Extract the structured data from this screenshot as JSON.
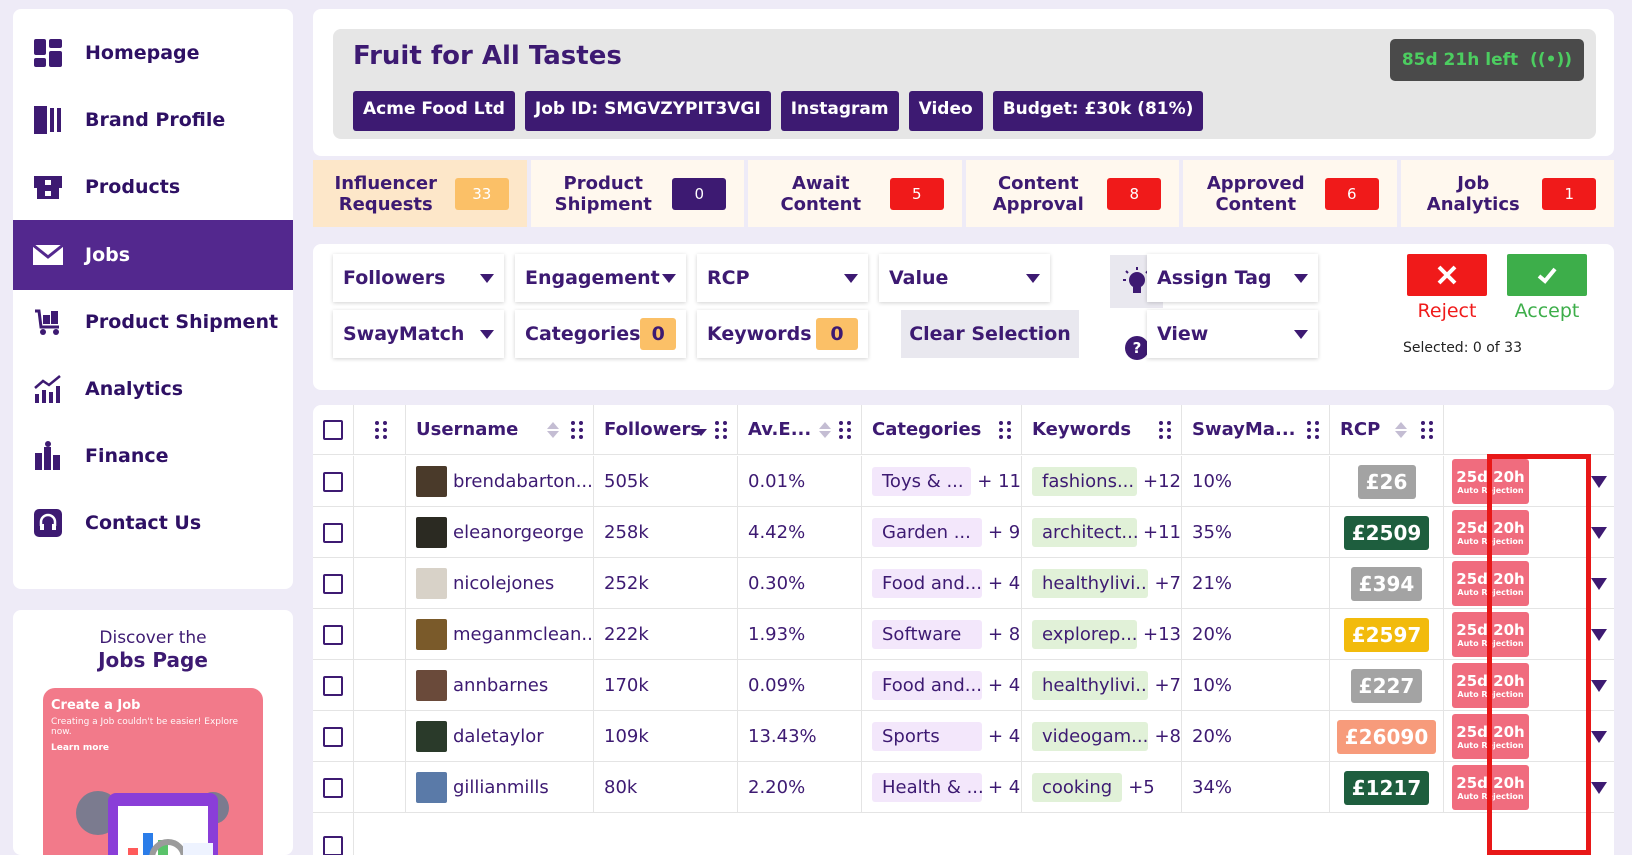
{
  "sidebar": {
    "items": [
      {
        "label": "Homepage",
        "icon": "dashboard-icon"
      },
      {
        "label": "Brand Profile",
        "icon": "profile-icon"
      },
      {
        "label": "Products",
        "icon": "products-icon"
      },
      {
        "label": "Jobs",
        "icon": "mail-icon",
        "active": true
      },
      {
        "label": "Product Shipment",
        "icon": "shipment-icon"
      },
      {
        "label": "Analytics",
        "icon": "analytics-icon"
      },
      {
        "label": "Finance",
        "icon": "finance-icon"
      },
      {
        "label": "Contact Us",
        "icon": "headset-icon"
      }
    ]
  },
  "promo": {
    "line1": "Discover the",
    "line2": "Jobs Page",
    "card_title": "Create a Job",
    "card_text": "Creating a Job couldn't be easier! Explore now.",
    "card_link": "Learn more"
  },
  "job": {
    "title": "Fruit for All Tastes",
    "tags": [
      "Acme Food Ltd",
      "Job ID: SMGVZYPIT3VGI",
      "Instagram",
      "Video",
      "Budget: £30k (81%)"
    ],
    "time_left": "85d 21h left",
    "time_left_color": "#4ccd60"
  },
  "tabs": [
    {
      "label": "Influencer Requests",
      "count": "33",
      "color": "#fbc067"
    },
    {
      "label": "Product Shipment",
      "count": "0",
      "color": "#3d1a72"
    },
    {
      "label": "Await Content",
      "count": "5",
      "color": "#f01a1a"
    },
    {
      "label": "Content Approval",
      "count": "8",
      "color": "#f01a1a"
    },
    {
      "label": "Approved Content",
      "count": "6",
      "color": "#f01a1a"
    },
    {
      "label": "Job Analytics",
      "count": "1",
      "color": "#f01a1a"
    }
  ],
  "filters": {
    "followers": "Followers",
    "engagement": "Engagement",
    "rcp": "RCP",
    "value": "Value",
    "swaymatch": "SwayMatch",
    "categories": "Categories",
    "categories_count": "0",
    "keywords": "Keywords",
    "keywords_count": "0",
    "clear": "Clear Selection",
    "assign_tag": "Assign Tag",
    "view": "View",
    "help": "?"
  },
  "actions": {
    "reject": "Reject",
    "accept": "Accept",
    "selected": "Selected: 0 of 33"
  },
  "table": {
    "columns": [
      "Username",
      "Followers",
      "Av.E...",
      "Categories",
      "Keywords",
      "SwayMa...",
      "RCP"
    ],
    "rows": [
      {
        "username": "brendabarton...",
        "followers": "505k",
        "engagement": "0.01%",
        "category": "Toys & ...",
        "cat_more": "+ 11",
        "keyword": "fashions...",
        "kw_more": "+12",
        "swaymatch": "10%",
        "rcp": "£26",
        "rcp_color": "#a3a3a3",
        "expiry": "25d 20h",
        "expiry_note": "Auto Rejection",
        "avatar_color": "#4a3a2a"
      },
      {
        "username": "eleanorgeorge",
        "followers": "258k",
        "engagement": "4.42%",
        "category": "Garden ...",
        "cat_more": "+ 9",
        "keyword": "architect...",
        "kw_more": "+11",
        "swaymatch": "35%",
        "rcp": "£2509",
        "rcp_color": "#1e5e3e",
        "expiry": "25d 20h",
        "expiry_note": "Auto Rejection",
        "avatar_color": "#2b2a22"
      },
      {
        "username": "nicolejones",
        "followers": "252k",
        "engagement": "0.30%",
        "category": "Food and...",
        "cat_more": "+ 4",
        "keyword": "healthylivi...",
        "kw_more": "+7",
        "swaymatch": "21%",
        "rcp": "£394",
        "rcp_color": "#a3a3a3",
        "expiry": "25d 20h",
        "expiry_note": "Auto Rejection",
        "avatar_color": "#d8d2c8"
      },
      {
        "username": "meganmclean...",
        "followers": "222k",
        "engagement": "1.93%",
        "category": "Software",
        "cat_more": "+ 8",
        "keyword": "explorep...",
        "kw_more": "+13",
        "swaymatch": "20%",
        "rcp": "£2597",
        "rcp_color": "#f2bb0c",
        "expiry": "25d 20h",
        "expiry_note": "Auto Rejection",
        "avatar_color": "#7a5a2a"
      },
      {
        "username": "annbarnes",
        "followers": "170k",
        "engagement": "0.09%",
        "category": "Food and...",
        "cat_more": "+ 4",
        "keyword": "healthylivi...",
        "kw_more": "+7",
        "swaymatch": "10%",
        "rcp": "£227",
        "rcp_color": "#a3a3a3",
        "expiry": "25d 20h",
        "expiry_note": "Auto Rejection",
        "avatar_color": "#6a4a3a"
      },
      {
        "username": "daletaylor",
        "followers": "109k",
        "engagement": "13.43%",
        "category": "Sports",
        "cat_more": "+ 4",
        "keyword": "videogam...",
        "kw_more": "+8",
        "swaymatch": "20%",
        "rcp": "£26090",
        "rcp_color": "#f79b7b",
        "expiry": "25d 20h",
        "expiry_note": "Auto Rejection",
        "avatar_color": "#2a3a2a"
      },
      {
        "username": "gillianmills",
        "followers": "80k",
        "engagement": "2.20%",
        "category": "Health & ...",
        "cat_more": "+ 4",
        "keyword": "cooking",
        "kw_more": "+5",
        "swaymatch": "34%",
        "rcp": "£1217",
        "rcp_color": "#1e5e3e",
        "expiry": "25d 20h",
        "expiry_note": "Auto Rejection",
        "avatar_color": "#5a7aa8"
      }
    ]
  }
}
